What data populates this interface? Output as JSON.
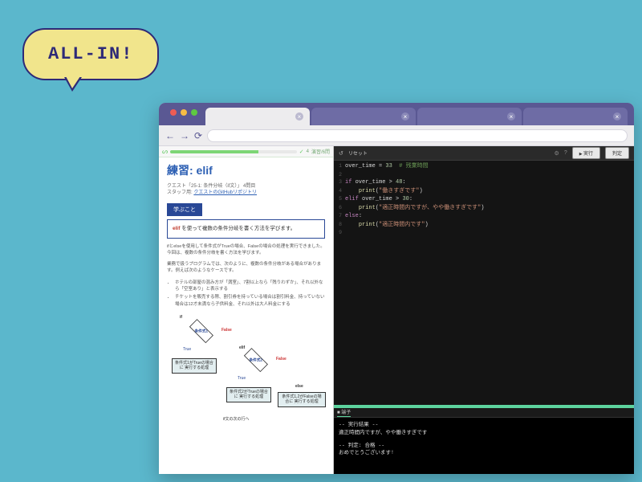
{
  "speech": "ALL-IN!",
  "browser": {
    "tabs": [
      {
        "active": true
      },
      {
        "active": false
      },
      {
        "active": false
      },
      {
        "active": false
      }
    ]
  },
  "progress": {
    "ratio": "4",
    "label": "演習/6問"
  },
  "lesson": {
    "title": "練習: elif",
    "meta1": "クエスト「25-1: 条件分岐（if文）」 4問目",
    "meta2_prefix": "スタッフ用: ",
    "meta2_link": "クエストのGitHubリポジトリ",
    "section1": "学ぶこと",
    "learn_kw": "elif",
    "learn_text": " を使って複数の条件分岐を書く方法を学びます。",
    "p1": "ifとelseを使用して条件式がTrueの場合、Falseの場合の処理を実行できました。今回は、複数の条件分岐を書く方法を学びます。",
    "p2": "業務で扱うプログラムでは、次のように、複数の条件分岐がある場合があります。例えば次のようなケースです。",
    "b1": "ホテルの部屋の混み方が「満室」、7割以上なら「残りわずか」、それ以外なら「空室あり」と表示する",
    "b2": "チケットを販売する際、割引券を持っている場合は割引料金、持っていない場合は12才未満なら子供料金、それ以外は大人料金にする",
    "diagram": {
      "start": "if",
      "cond1": "条件式1",
      "cond2": "条件式2",
      "box1": "条件式1がTrueの場合に\n実行する処理",
      "box2": "条件式2がTrueの場合に\n実行する処理",
      "box3": "条件式1,2がFalseの場合に\n実行する処理",
      "true": "True",
      "false": "False",
      "elif": "elif",
      "else": "else",
      "end": "if文の次の行へ"
    }
  },
  "editor": {
    "reset": "リセット",
    "run": "実行",
    "judge": "判定",
    "lines": [
      {
        "n": 1,
        "seg": [
          {
            "c": "v",
            "t": "over_time"
          },
          {
            "c": "o",
            "t": " = "
          },
          {
            "c": "n",
            "t": "33"
          },
          {
            "c": "c",
            "t": "  # 残業時間"
          }
        ]
      },
      {
        "n": 2,
        "seg": []
      },
      {
        "n": 3,
        "seg": [
          {
            "c": "k",
            "t": "if"
          },
          {
            "c": "v",
            "t": " over_time "
          },
          {
            "c": "o",
            "t": "> "
          },
          {
            "c": "n",
            "t": "48"
          },
          {
            "c": "o",
            "t": ":"
          }
        ]
      },
      {
        "n": 4,
        "seg": [
          {
            "c": "v",
            "t": "    "
          },
          {
            "c": "f",
            "t": "print"
          },
          {
            "c": "o",
            "t": "("
          },
          {
            "c": "s",
            "t": "\"働きすぎです\""
          },
          {
            "c": "o",
            "t": ")"
          }
        ]
      },
      {
        "n": 5,
        "seg": [
          {
            "c": "k",
            "t": "elif"
          },
          {
            "c": "v",
            "t": " over_time "
          },
          {
            "c": "o",
            "t": "> "
          },
          {
            "c": "n",
            "t": "30"
          },
          {
            "c": "o",
            "t": ":"
          }
        ]
      },
      {
        "n": 6,
        "seg": [
          {
            "c": "v",
            "t": "    "
          },
          {
            "c": "f",
            "t": "print"
          },
          {
            "c": "o",
            "t": "("
          },
          {
            "c": "s",
            "t": "\"適正時間内ですが、やや働きすぎです\""
          },
          {
            "c": "o",
            "t": ")"
          }
        ]
      },
      {
        "n": 7,
        "seg": [
          {
            "c": "k",
            "t": "else"
          },
          {
            "c": "o",
            "t": ":"
          }
        ]
      },
      {
        "n": 8,
        "seg": [
          {
            "c": "v",
            "t": "    "
          },
          {
            "c": "f",
            "t": "print"
          },
          {
            "c": "o",
            "t": "("
          },
          {
            "c": "s",
            "t": "\"適正時間内です\""
          },
          {
            "c": "o",
            "t": ")"
          }
        ]
      },
      {
        "n": 9,
        "seg": []
      }
    ]
  },
  "terminal": {
    "tab1": "■ 端子",
    "out_hdr": "-- 実行結果 --",
    "out_line": "適正時間内ですが、やや働きすぎです",
    "judge_hdr": "-- 判定: 合格 --",
    "judge_line": "おめでとうございます!"
  }
}
